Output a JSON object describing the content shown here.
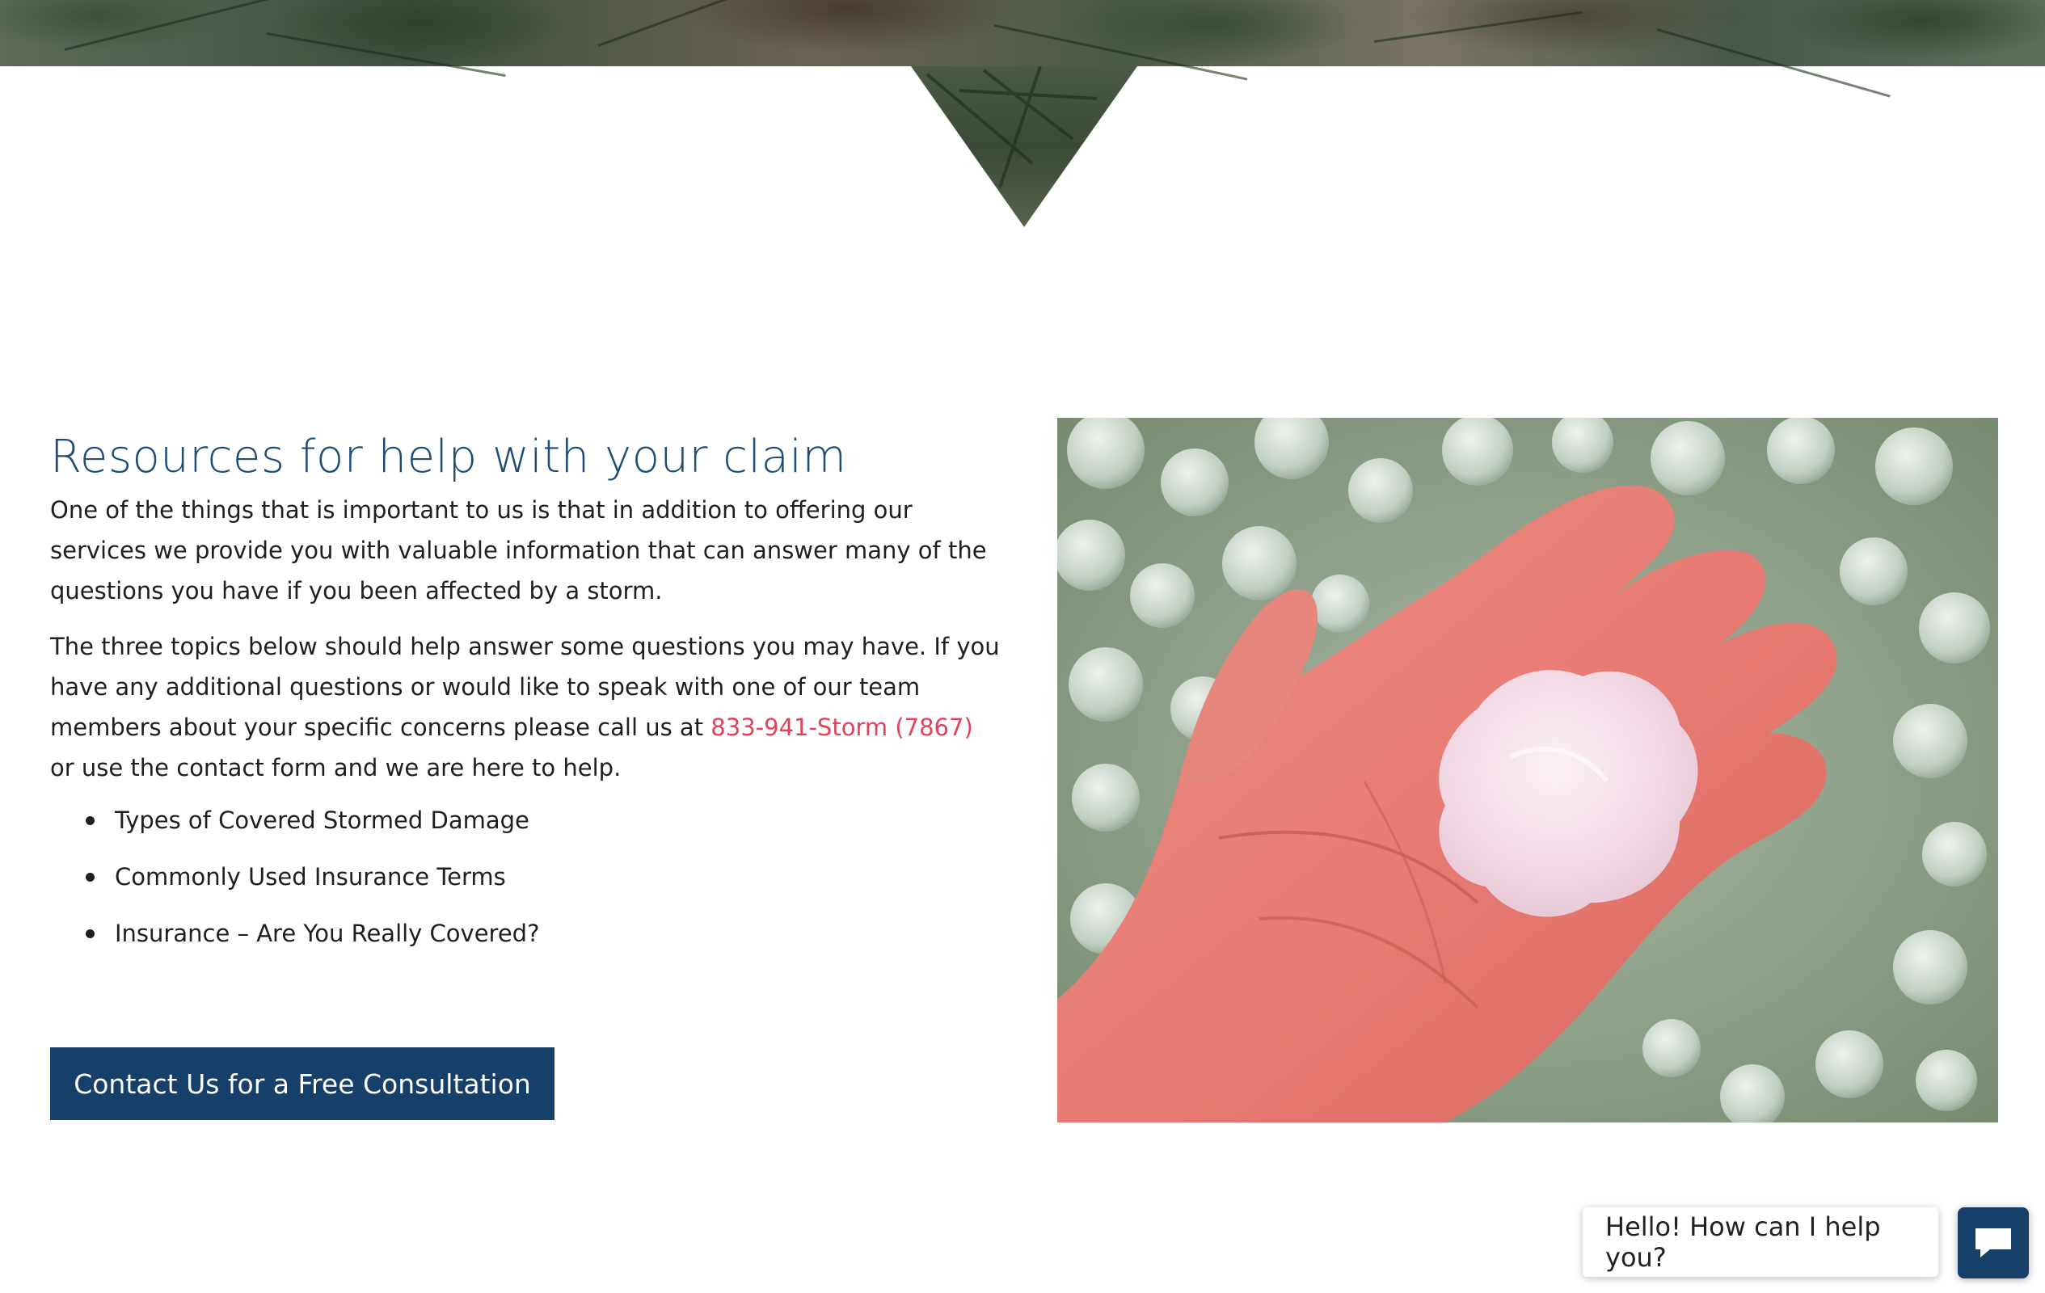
{
  "hero": {
    "image": "palm-trees-photo"
  },
  "section": {
    "title": "Resources for help with your claim",
    "paragraph1": "One of the things that is important to us is that in addition to offering our services we provide you with valuable information that can answer many of the questions you have if you been affected by a storm.",
    "paragraph2_before": "The three topics below should help answer some questions you may have. If you have any additional questions or would like to speak with one of our team members about your specific concerns please call us at ",
    "phone_link": "833-941-Storm (7867)",
    "paragraph2_after": "  or use the contact form and we are here to help.",
    "topics": [
      "Types of Covered Stormed Damage",
      "Commonly Used Insurance Terms",
      "Insurance – Are You Really Covered?"
    ],
    "cta_label": "Contact Us for a Free Consultation"
  },
  "photo": {
    "subject": "hand-holding-hailstone-photo"
  },
  "chat": {
    "greeting": "Hello! How can I help you?",
    "icon": "chat-icon"
  },
  "colors": {
    "brand_blue": "#163f69",
    "heading_blue": "#1d4c78",
    "link_red": "#e0435a",
    "text": "#1f1f1f"
  }
}
